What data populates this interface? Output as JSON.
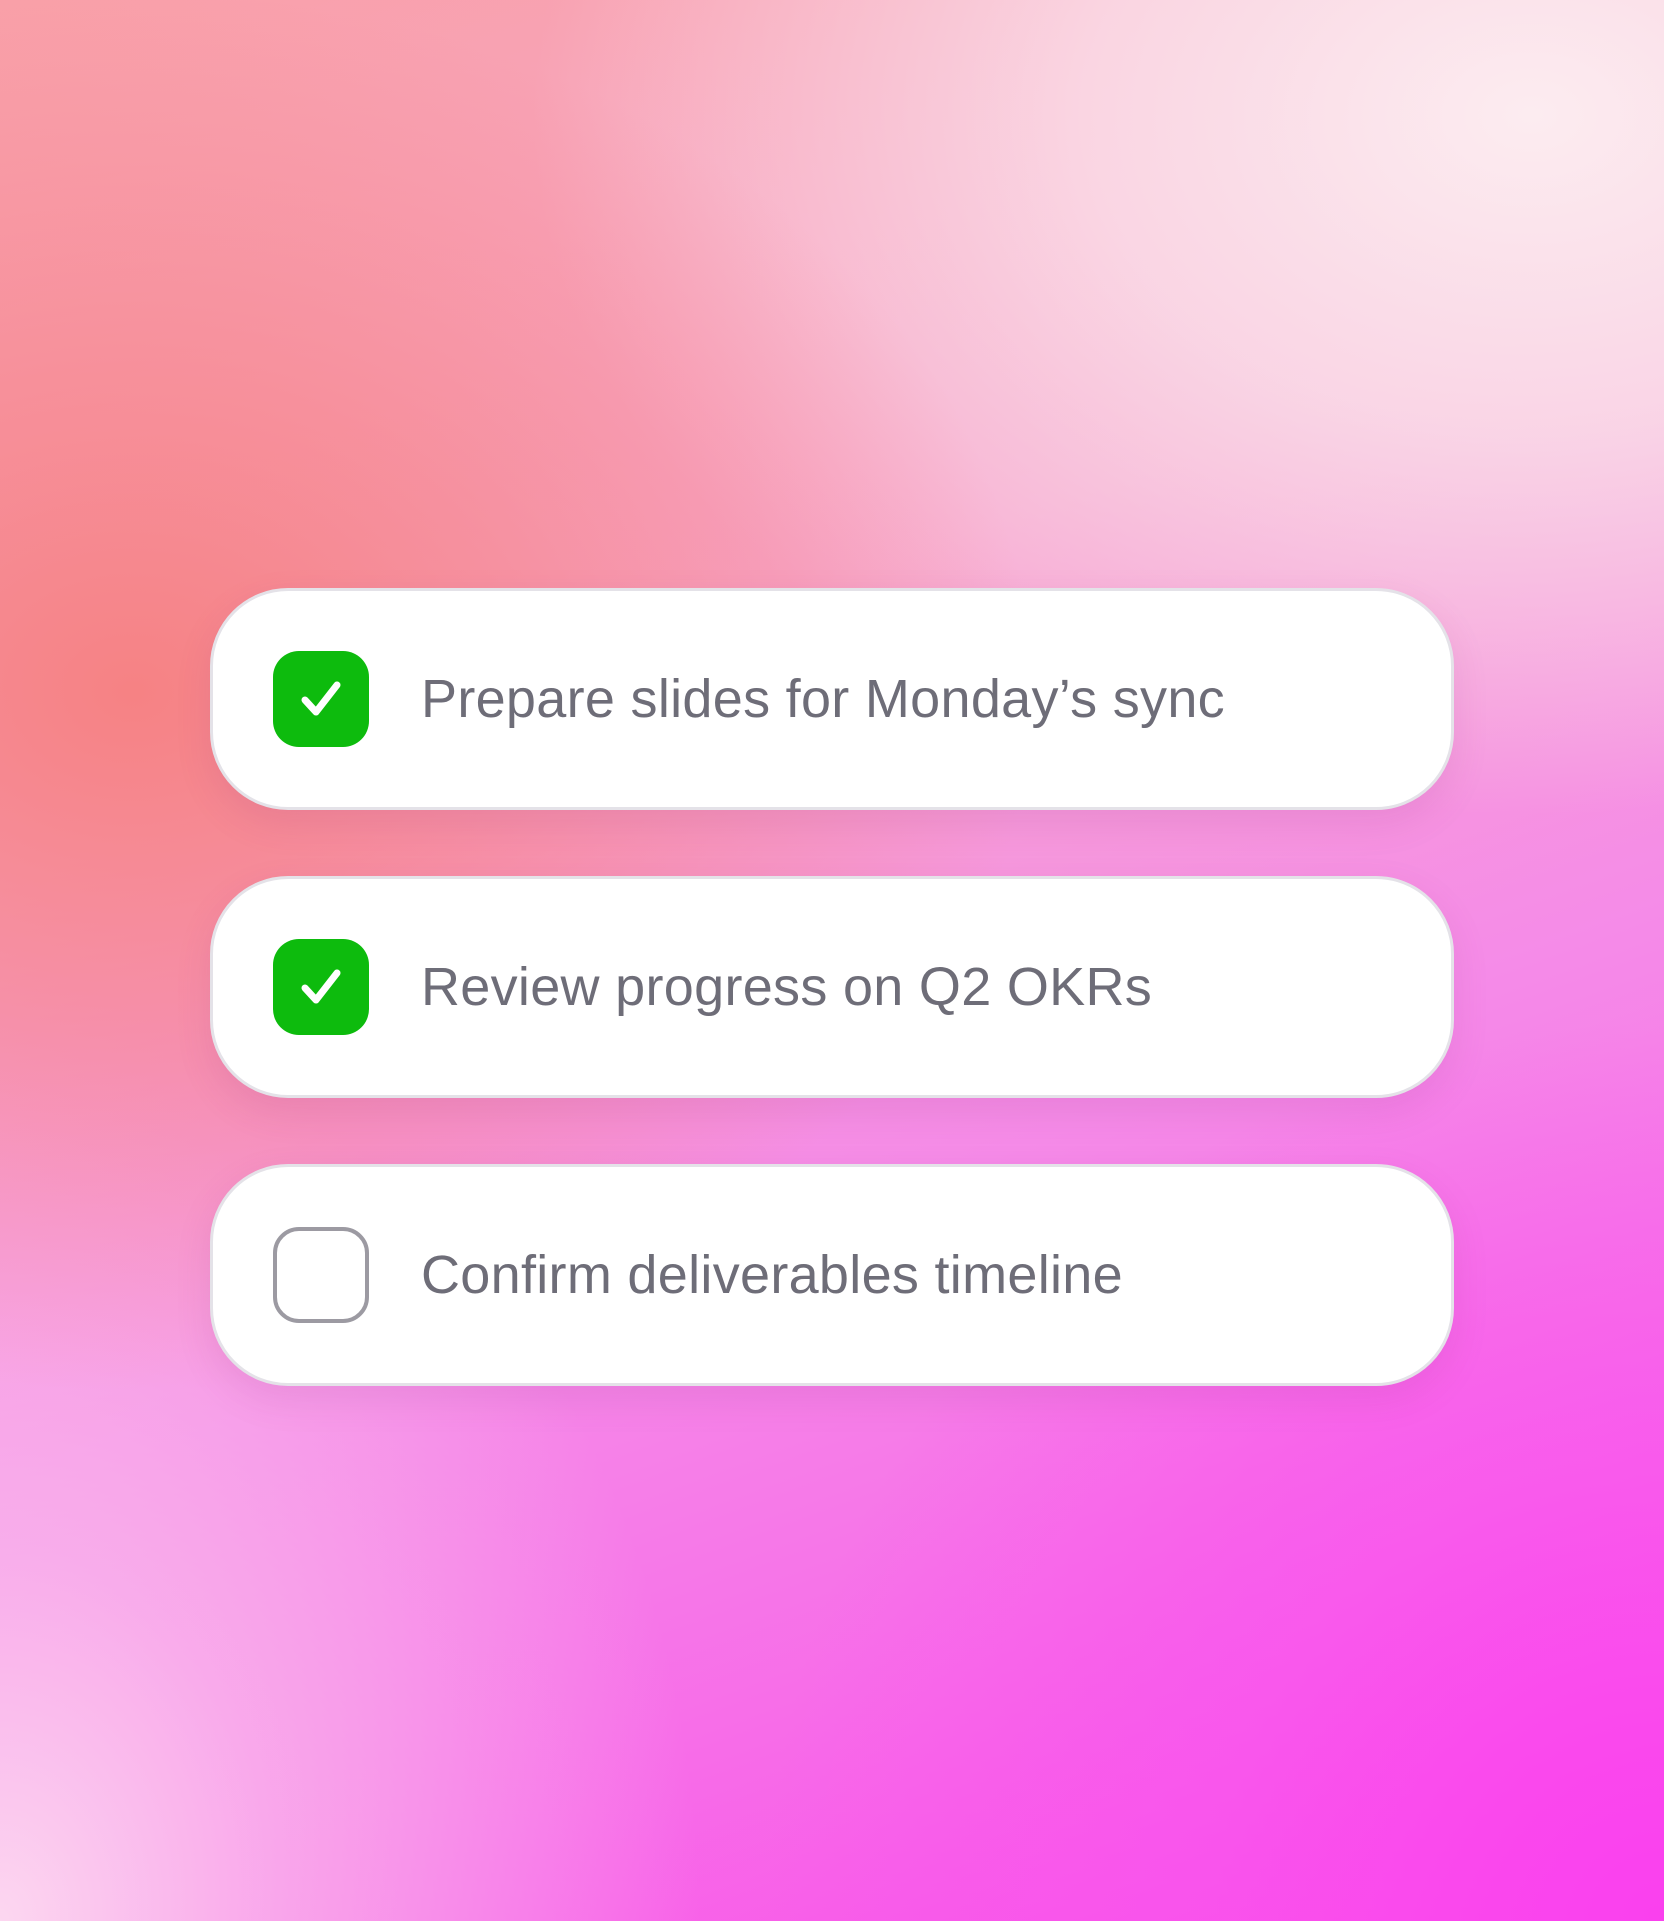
{
  "colors": {
    "checked_fill": "#0dbb0d",
    "check_mark": "#ffffff",
    "unchecked_border": "#9c9aa2",
    "label_text": "#6e6d78",
    "card_background": "#ffffff"
  },
  "tasks": [
    {
      "label": "Prepare slides for Monday’s sync",
      "checked": true,
      "icon": "checkmark-icon"
    },
    {
      "label": "Review progress on Q2 OKRs",
      "checked": true,
      "icon": "checkmark-icon"
    },
    {
      "label": "Confirm deliverables timeline",
      "checked": false,
      "icon": "empty-checkbox-icon"
    }
  ]
}
